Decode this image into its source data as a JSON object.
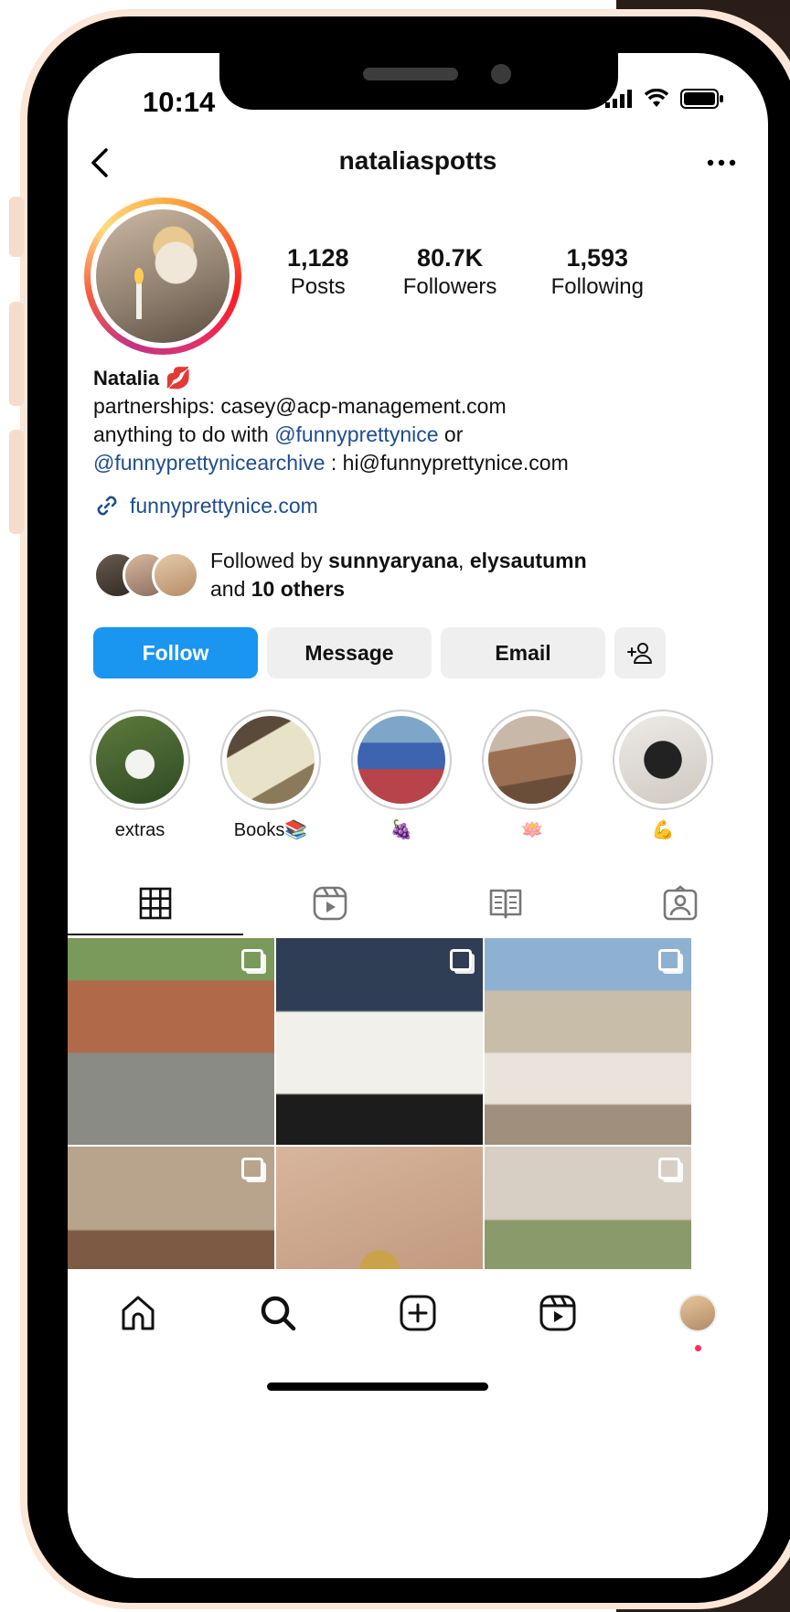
{
  "status_bar": {
    "time": "10:14"
  },
  "header": {
    "username": "nataliaspotts"
  },
  "stats": [
    {
      "value": "1,128",
      "label": "Posts"
    },
    {
      "value": "80.7K",
      "label": "Followers"
    },
    {
      "value": "1,593",
      "label": "Following"
    }
  ],
  "bio": {
    "name": "Natalia",
    "name_emoji": "💋",
    "line1": "partnerships: casey@acp-management.com",
    "line2_prefix": "anything to do with ",
    "line2_mention": "@funnyprettynice",
    "line2_suffix": " or",
    "line3_mention": "@funnyprettynicearchive",
    "line3_suffix": " : hi@funnyprettynice.com",
    "link": "funnyprettynice.com"
  },
  "followed_by": {
    "prefix": "Followed by ",
    "user1": "sunnyaryana",
    "sep": ", ",
    "user2": "elysautumn",
    "and": "and ",
    "others": "10 others"
  },
  "buttons": {
    "follow": "Follow",
    "message": "Message",
    "email": "Email"
  },
  "highlights": [
    {
      "label": "extras",
      "color": "#5e7a3c"
    },
    {
      "label": "Books📚",
      "color": "#c9b48a"
    },
    {
      "label": "🍇",
      "color": "#b9434a"
    },
    {
      "label": "🪷",
      "color": "#9a6f52"
    },
    {
      "label": "💪",
      "color": "#d9d4cf"
    }
  ],
  "grid_colors": [
    "#9b6e4f",
    "#4b5d72",
    "#b6ab9a",
    "#8c7d68",
    "#d7b59c",
    "#a08f7d"
  ],
  "colors": {
    "accent": "#1a95f0",
    "link": "#1f4d8f"
  }
}
